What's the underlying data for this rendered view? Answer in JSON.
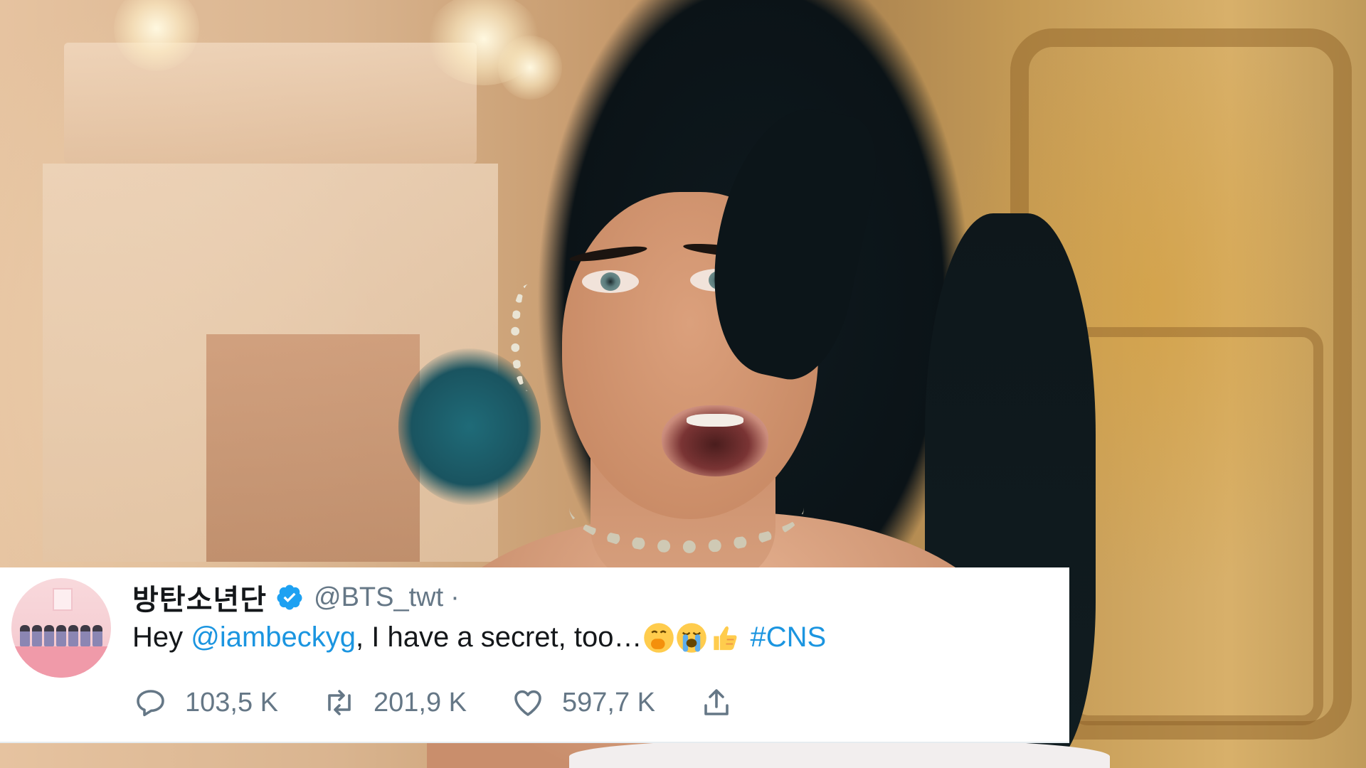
{
  "tweet": {
    "display_name": "방탄소년단",
    "handle": "@BTS_twt",
    "separator": "·",
    "text_prefix": "Hey ",
    "mention": "@iambeckyg",
    "text_middle": ", I have a secret, too…",
    "emojis": [
      "face-with-hand-over-mouth-emoji",
      "loudly-crying-face-emoji",
      "thumbs-up-emoji"
    ],
    "hashtag": "#CNS",
    "replies": "103,5 K",
    "retweets": "201,9 K",
    "likes": "597,7 K",
    "link_color": "#1b95e0",
    "verified_color": "#1da1f2",
    "icons": {
      "reply": "reply-icon",
      "retweet": "retweet-icon",
      "like": "heart-icon",
      "share": "share-icon",
      "verified": "verified-badge-icon"
    }
  }
}
